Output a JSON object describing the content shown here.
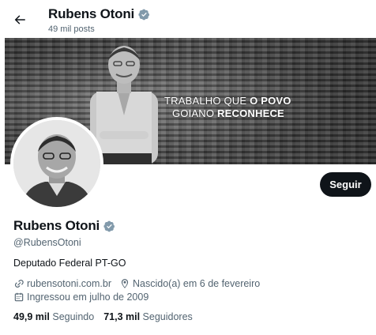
{
  "header": {
    "back_icon": "arrow-left-icon",
    "title": "Rubens Otoni",
    "posts": "49 mil posts"
  },
  "banner": {
    "line1_pre": "TRABALHO QUE ",
    "line1_bold": "O POVO",
    "line2_pre": "GOIANO ",
    "line2_bold": "RECONHECE"
  },
  "profile": {
    "name": "Rubens Otoni",
    "handle": "@RubensOtoni",
    "bio": "Deputado Federal PT-GO",
    "website": "rubensotoni.com.br",
    "birthday": "Nascido(a) em 6 de fevereiro",
    "joined": "Ingressou em julho de 2009",
    "follow_label": "Seguir",
    "verified_icon": "verified-badge-icon"
  },
  "stats": {
    "following_count": "49,9 mil",
    "following_label": "Seguindo",
    "followers_count": "71,3 mil",
    "followers_label": "Seguidores"
  },
  "colors": {
    "text": "#0f1419",
    "secondary": "#536471",
    "button_bg": "#0f1419",
    "button_text": "#ffffff",
    "badge": "#829aab"
  }
}
